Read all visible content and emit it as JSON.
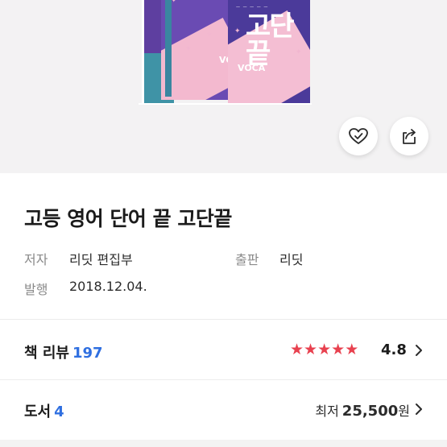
{
  "cover": {
    "title_text": "고단끝",
    "voca_text": "VOCA",
    "colors": {
      "purple": "#5e3fa0",
      "pink": "#f4bed3",
      "teal": "#3f93a6"
    }
  },
  "actions": {
    "like_icon": "heart-check-icon",
    "share_icon": "share-icon"
  },
  "book": {
    "title": "고등 영어 단어 끝 고단끝",
    "author_label": "저자",
    "author": "리딧 편집부",
    "publisher_label": "출판",
    "publisher": "리딧",
    "date_label": "발행",
    "date": "2018.12.04."
  },
  "reviews": {
    "label": "책 리뷰",
    "count": "197",
    "stars": 5,
    "rating": "4.8",
    "accent_color": "#e8414f"
  },
  "listings": {
    "label": "도서",
    "count": "4",
    "price_prefix": "최저",
    "price": "25,500",
    "price_unit": "원",
    "count_color": "#2f6fe0"
  }
}
